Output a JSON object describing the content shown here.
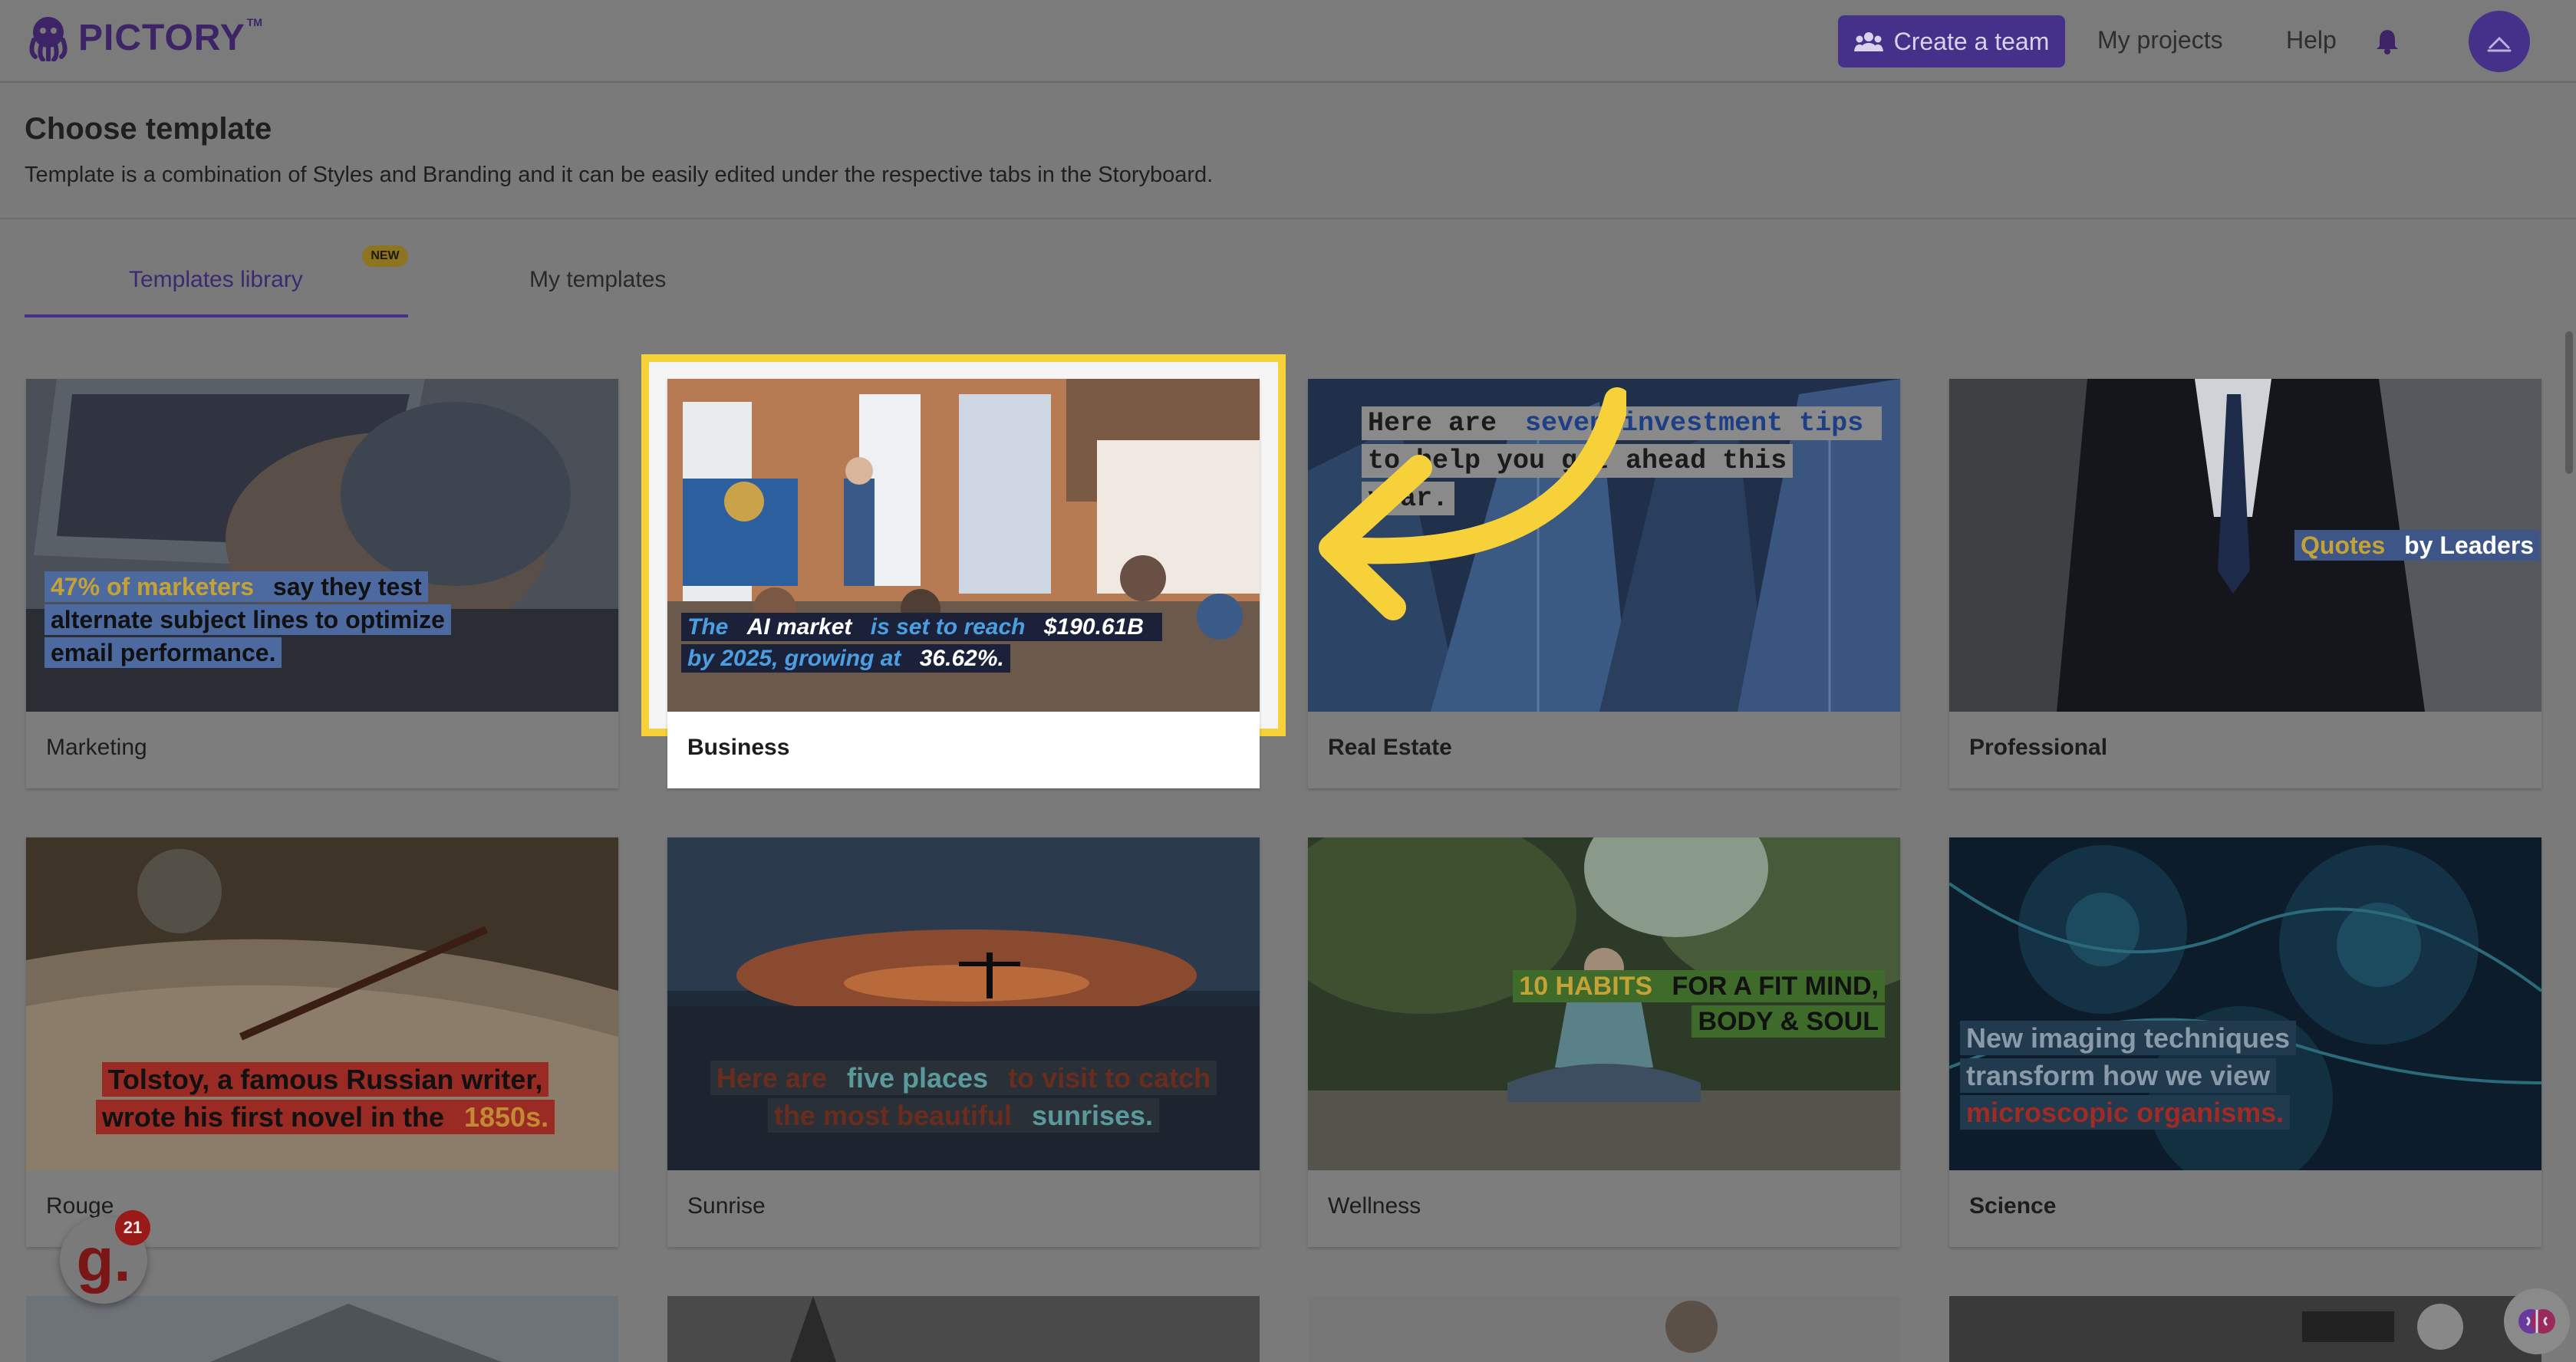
{
  "header": {
    "logo_text": "PICTORY",
    "logo_tm": "TM",
    "create_team_label": "Create a team",
    "my_projects_label": "My projects",
    "help_label": "Help"
  },
  "page": {
    "title": "Choose template",
    "subtitle": "Template is a combination of Styles and Branding and it can be easily edited under the respective tabs in the Storyboard."
  },
  "tabs": {
    "library_label": "Templates library",
    "new_badge": "NEW",
    "mine_label": "My templates"
  },
  "cards": [
    {
      "label": "Marketing",
      "overlay_a": "47% of marketers",
      "overlay_b": " say they test alternate subject lines to optimize email performance."
    },
    {
      "label": "Business",
      "overlay_a": "The ",
      "overlay_b": "AI market",
      "overlay_c": " is set to reach ",
      "overlay_d": "$190.61B",
      "overlay_e": " by 2025, growing at ",
      "overlay_f": "36.62%."
    },
    {
      "label": "Real Estate",
      "overlay_a": "Here are ",
      "overlay_b": "seven investment tips",
      "overlay_c": " to help you get ahead this year."
    },
    {
      "label": "Professional",
      "overlay_a": "Quotes",
      "overlay_b": " by Leaders"
    },
    {
      "label": "Rouge",
      "overlay_a": "Tolstoy, a famous Russian writer, wrote his first novel in the ",
      "overlay_b": "1850s."
    },
    {
      "label": "Sunrise",
      "overlay_a": "Here are ",
      "overlay_b": "five places",
      "overlay_c": " to visit to catch the most beautiful ",
      "overlay_d": "sunrises."
    },
    {
      "label": "Wellness",
      "overlay_a": "10 HABITS",
      "overlay_b": " FOR A FIT MIND,",
      "overlay_c": "BODY & SOUL"
    },
    {
      "label": "Science",
      "overlay_a": "New imaging techniques transform how we view ",
      "overlay_b": "microscopic organisms."
    }
  ],
  "widgets": {
    "g_letter": "g.",
    "g_count": "21"
  },
  "icons": [
    "octopus-logo-icon",
    "team-icon",
    "bell-icon",
    "avatar-icon",
    "brain-icon"
  ],
  "colors": {
    "brand_purple": "#6a4bd4",
    "highlight_yellow": "#f6d13a"
  }
}
